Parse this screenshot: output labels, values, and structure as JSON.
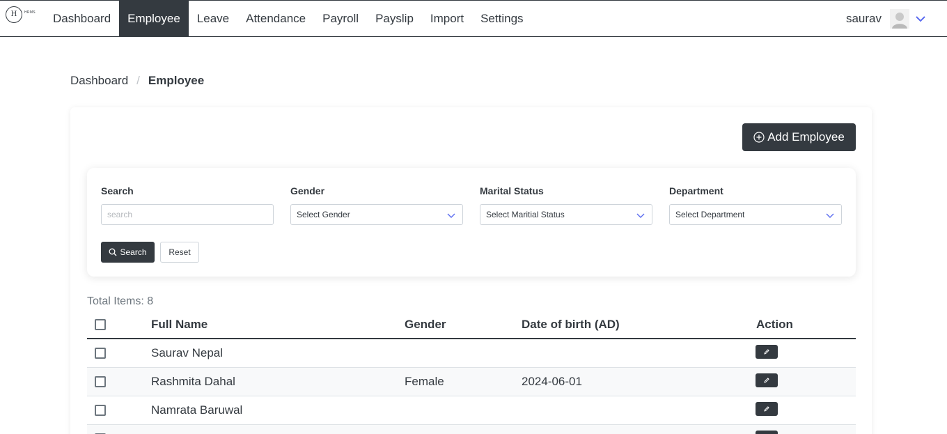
{
  "logo": {
    "letter": "H",
    "tag": "HRMS"
  },
  "nav": {
    "items": [
      {
        "label": "Dashboard"
      },
      {
        "label": "Employee",
        "active": true
      },
      {
        "label": "Leave"
      },
      {
        "label": "Attendance"
      },
      {
        "label": "Payroll"
      },
      {
        "label": "Payslip"
      },
      {
        "label": "Import"
      },
      {
        "label": "Settings"
      }
    ],
    "user_name": "saurav"
  },
  "breadcrumb": {
    "home": "Dashboard",
    "current": "Employee"
  },
  "add_button": {
    "label": "Add Employee"
  },
  "filters": {
    "search_label": "Search",
    "search_placeholder": "search",
    "gender_label": "Gender",
    "gender_value": "Select Gender",
    "marital_label": "Marital Status",
    "marital_value": "Select Maritial Status",
    "department_label": "Department",
    "department_value": "Select Department",
    "search_button": "Search",
    "reset_button": "Reset"
  },
  "total_items": "Total Items: 8",
  "table": {
    "headers": [
      "Full Name",
      "Gender",
      "Date of birth (AD)",
      "Action"
    ],
    "rows": [
      {
        "name": "Saurav Nepal",
        "gender": "",
        "dob": ""
      },
      {
        "name": "Rashmita Dahal",
        "gender": "Female",
        "dob": "2024-06-01"
      },
      {
        "name": "Namrata Baruwal",
        "gender": "",
        "dob": ""
      },
      {
        "name": "",
        "gender": "",
        "dob": ""
      }
    ]
  },
  "colors": {
    "primary": "#343a40",
    "accent": "#5b6cf0",
    "muted": "#6c757d"
  },
  "icons": [
    "user-avatar-icon",
    "chevron-down-icon",
    "plus-circle-icon",
    "search-icon",
    "pencil-icon"
  ]
}
